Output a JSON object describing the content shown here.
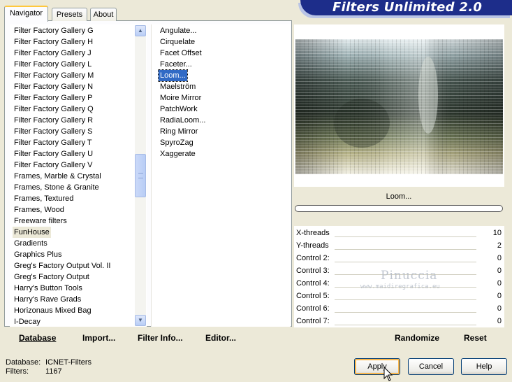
{
  "banner": {
    "title": "Filters Unlimited 2.0"
  },
  "tabs": [
    {
      "label": "Navigator",
      "active": true
    },
    {
      "label": "Presets",
      "active": false
    },
    {
      "label": "About",
      "active": false
    }
  ],
  "categories": [
    "Filter Factory Gallery G",
    "Filter Factory Gallery H",
    "Filter Factory Gallery J",
    "Filter Factory Gallery L",
    "Filter Factory Gallery M",
    "Filter Factory Gallery N",
    "Filter Factory Gallery P",
    "Filter Factory Gallery Q",
    "Filter Factory Gallery R",
    "Filter Factory Gallery S",
    "Filter Factory Gallery T",
    "Filter Factory Gallery U",
    "Filter Factory Gallery V",
    "Frames, Marble & Crystal",
    "Frames, Stone & Granite",
    "Frames, Textured",
    "Frames, Wood",
    "Freeware filters",
    "FunHouse",
    "Gradients",
    "Graphics Plus",
    "Greg's Factory Output Vol. II",
    "Greg's Factory Output",
    "Harry's Button Tools",
    "Harry's Rave Grads",
    "Horizonaus Mixed Bag",
    "I-Decay"
  ],
  "selected_category": "FunHouse",
  "filters": [
    "Angulate...",
    "Cirquelate",
    "Facet Offset",
    "Faceter...",
    "Loom...",
    "Maelström",
    "Moire Mirror",
    "PatchWork",
    "RadiaLoom...",
    "Ring Mirror",
    "SpyroZag",
    "Xaggerate"
  ],
  "selected_filter": "Loom...",
  "nav_buttons": {
    "database": "Database",
    "import": "Import...",
    "filter_info": "Filter Info...",
    "editor": "Editor..."
  },
  "preview": {
    "filter_name": "Loom..."
  },
  "params": [
    {
      "label": "X-threads",
      "value": "10"
    },
    {
      "label": "Y-threads",
      "value": "2"
    },
    {
      "label": "Control 2:",
      "value": "0"
    },
    {
      "label": "Control 3:",
      "value": "0"
    },
    {
      "label": "Control 4:",
      "value": "0"
    },
    {
      "label": "Control 5:",
      "value": "0"
    },
    {
      "label": "Control 6:",
      "value": "0"
    },
    {
      "label": "Control 7:",
      "value": "0"
    }
  ],
  "actions": {
    "randomize": "Randomize",
    "reset": "Reset"
  },
  "watermark": {
    "name": "Pinuccia",
    "url": "www.maidiregrafica.eu"
  },
  "status": {
    "database_label": "Database:",
    "database_value": "ICNET-Filters",
    "filters_label": "Filters:",
    "filters_value": "1167"
  },
  "dialog": {
    "apply": "Apply",
    "cancel": "Cancel",
    "help": "Help"
  },
  "colors": {
    "banner": "#1d2d8a",
    "selection": "#316ac5",
    "face": "#ece9d8"
  }
}
